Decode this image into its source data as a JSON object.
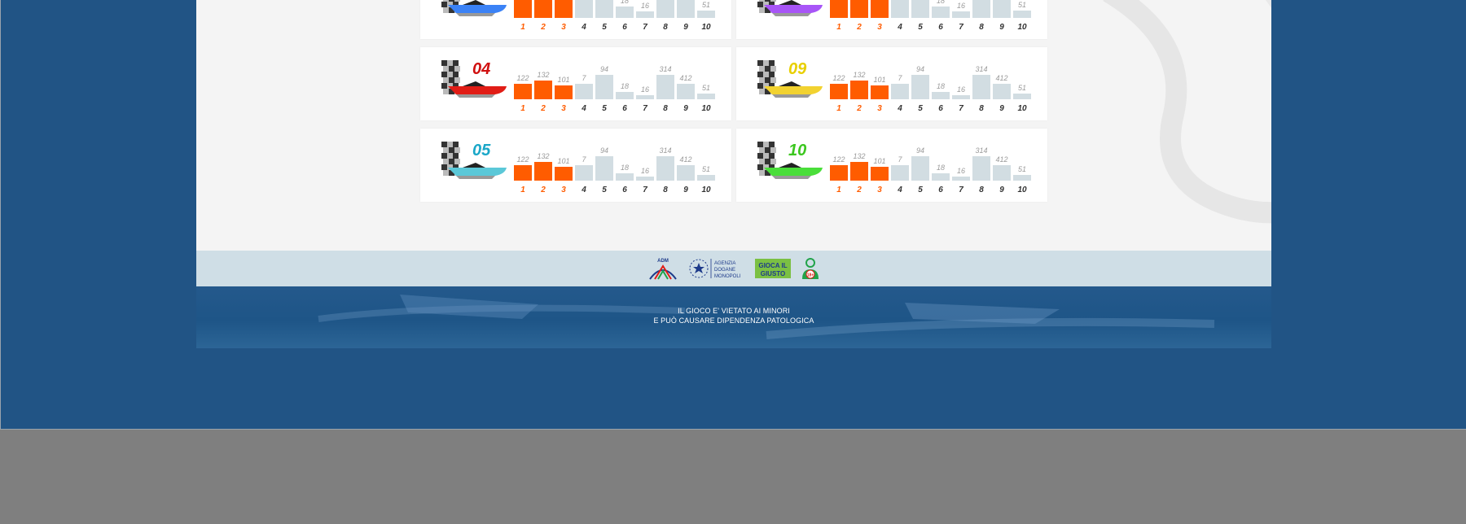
{
  "cards": [
    {
      "boat_number": "",
      "boat_color": "#3b82f6",
      "number_color": "#1aa0c8",
      "values": [
        "",
        "",
        "",
        "",
        "",
        "18",
        "16",
        "",
        "",
        "51"
      ],
      "positions": [
        "1",
        "2",
        "3",
        "4",
        "5",
        "6",
        "7",
        "8",
        "9",
        "10"
      ],
      "level": [
        0.85,
        1.0,
        0.8,
        0.85,
        1.0,
        0.45,
        0.25,
        1.0,
        0.85,
        0.3
      ]
    },
    {
      "boat_number": "",
      "boat_color": "#a855f7",
      "number_color": "#a855f7",
      "values": [
        "",
        "",
        "",
        "",
        "",
        "18",
        "16",
        "",
        "",
        "51"
      ],
      "positions": [
        "1",
        "2",
        "3",
        "4",
        "5",
        "6",
        "7",
        "8",
        "9",
        "10"
      ],
      "level": [
        0.85,
        1.0,
        0.8,
        0.85,
        1.0,
        0.45,
        0.25,
        1.0,
        0.85,
        0.3
      ]
    },
    {
      "boat_number": "04",
      "boat_color": "#e11d16",
      "number_color": "#d01010",
      "values": [
        "122",
        "132",
        "101",
        "7",
        "94",
        "18",
        "16",
        "314",
        "412",
        "51"
      ],
      "positions": [
        "1",
        "2",
        "3",
        "4",
        "5",
        "6",
        "7",
        "8",
        "9",
        "10"
      ],
      "level": [
        0.62,
        0.78,
        0.56,
        0.62,
        1.0,
        0.3,
        0.18,
        1.0,
        0.62,
        0.24
      ]
    },
    {
      "boat_number": "09",
      "boat_color": "#f2d230",
      "number_color": "#e8cf00",
      "values": [
        "122",
        "132",
        "101",
        "7",
        "94",
        "18",
        "16",
        "314",
        "412",
        "51"
      ],
      "positions": [
        "1",
        "2",
        "3",
        "4",
        "5",
        "6",
        "7",
        "8",
        "9",
        "10"
      ],
      "level": [
        0.62,
        0.78,
        0.56,
        0.62,
        1.0,
        0.3,
        0.18,
        1.0,
        0.62,
        0.24
      ]
    },
    {
      "boat_number": "05",
      "boat_color": "#5bc8d8",
      "number_color": "#1aa7c8",
      "values": [
        "122",
        "132",
        "101",
        "7",
        "94",
        "18",
        "16",
        "314",
        "412",
        "51"
      ],
      "positions": [
        "1",
        "2",
        "3",
        "4",
        "5",
        "6",
        "7",
        "8",
        "9",
        "10"
      ],
      "level": [
        0.62,
        0.78,
        0.56,
        0.62,
        1.0,
        0.3,
        0.18,
        1.0,
        0.62,
        0.24
      ]
    },
    {
      "boat_number": "10",
      "boat_color": "#4ade3a",
      "number_color": "#3cc71f",
      "values": [
        "122",
        "132",
        "101",
        "7",
        "94",
        "18",
        "16",
        "314",
        "412",
        "51"
      ],
      "positions": [
        "1",
        "2",
        "3",
        "4",
        "5",
        "6",
        "7",
        "8",
        "9",
        "10"
      ],
      "level": [
        0.62,
        0.78,
        0.56,
        0.62,
        1.0,
        0.3,
        0.18,
        1.0,
        0.62,
        0.24
      ]
    }
  ],
  "logos": {
    "adm_label": "ADM",
    "agency_lines": [
      "AGENZIA",
      "DOGANE",
      "MONOPOLI"
    ],
    "gioca_lines": [
      "GIOCA IL",
      "GIUSTO"
    ],
    "age_label": "18+"
  },
  "footer": {
    "line1": "IL GIOCO E' VIETATO AI MINORI",
    "line2": "E PUÒ CAUSARE DIPENDENZA PATOLOGICA"
  },
  "colors": {
    "top3": "#ff5c00",
    "rest": "#d2dde2",
    "page_bg": "#215485",
    "panel_bg": "#f4f4f4"
  }
}
